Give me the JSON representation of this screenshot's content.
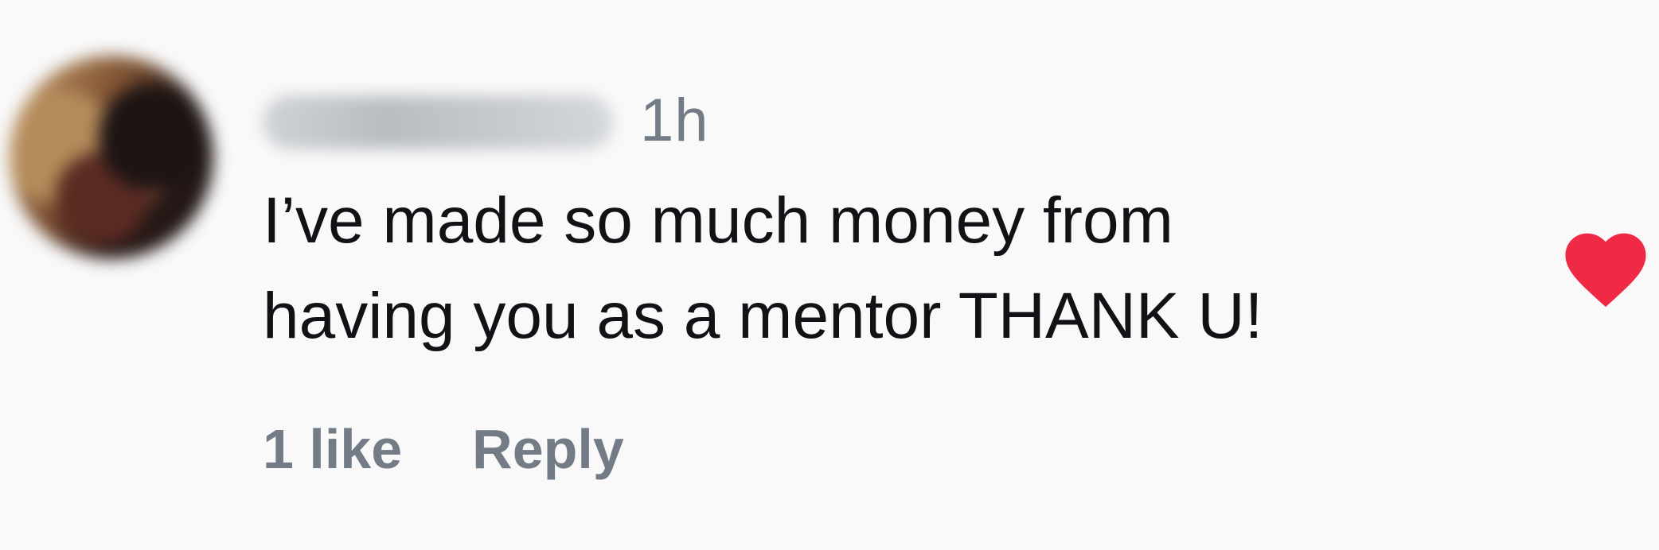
{
  "comment": {
    "avatar_icon": "user-avatar-blurred",
    "username": "",
    "timestamp": "1h",
    "text_lines": [
      "I’ve made so much money from",
      "having you as a mentor THANK U!"
    ],
    "likes_label": "1 like",
    "reply_label": "Reply",
    "heart_icon": "heart-filled-icon"
  },
  "colors": {
    "background": "#f9f9f9",
    "text_primary": "#101216",
    "text_secondary": "#737b86",
    "heart": "#f02a45"
  }
}
